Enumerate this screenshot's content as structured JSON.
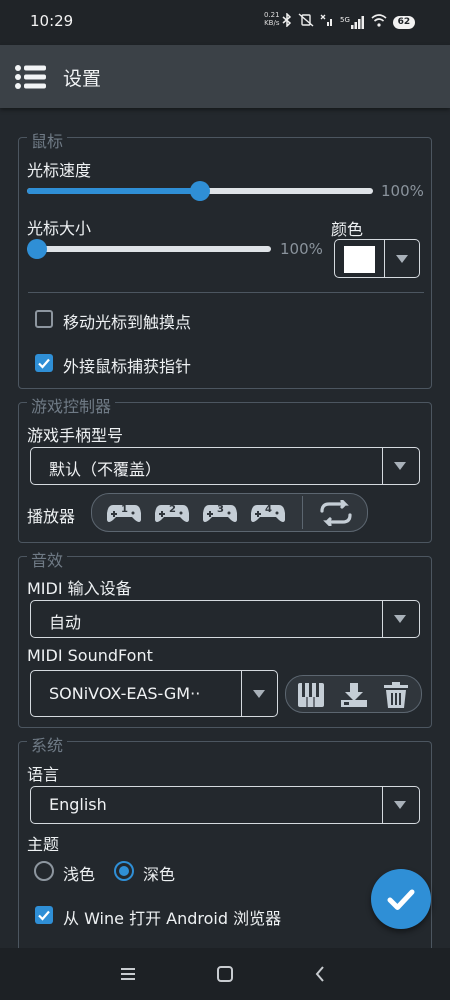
{
  "status_bar": {
    "time": "10:29",
    "net_speed_value": "0.21",
    "net_speed_unit": "KB/s",
    "network": "5G",
    "battery": "62"
  },
  "toolbar": {
    "title": "设置",
    "menu_icon": "list-menu-icon"
  },
  "mouse": {
    "legend": "鼠标",
    "cursor_speed_label": "光标速度",
    "cursor_speed_value": "100%",
    "cursor_speed_level": 0.5,
    "cursor_size_label": "光标大小",
    "cursor_size_value": "100%",
    "cursor_size_level": 0.0,
    "color_label": "颜色",
    "color_value": "#ffffff",
    "move_to_touch_label": "移动光标到触摸点",
    "move_to_touch_checked": false,
    "capture_pointer_label": "外接鼠标捕获指针",
    "capture_pointer_checked": true
  },
  "controller": {
    "legend": "游戏控制器",
    "model_label": "游戏手柄型号",
    "model_value": "默认（不覆盖）",
    "players_label": "播放器",
    "players": [
      "1",
      "2",
      "3",
      "4"
    ]
  },
  "audio": {
    "legend": "音效",
    "midi_input_label": "MIDI 输入设备",
    "midi_input_value": "自动",
    "soundfont_label": "MIDI SoundFont",
    "soundfont_value": "SONiVOX-EAS-GM··"
  },
  "system": {
    "legend": "系统",
    "language_label": "语言",
    "language_value": "English",
    "theme_label": "主题",
    "theme_light": "浅色",
    "theme_dark": "深色",
    "theme_selected": "dark",
    "open_browser_label": "从 Wine 打开 Android 浏览器",
    "open_browser_checked": true
  },
  "colors": {
    "accent": "#2f8fd6",
    "background": "#23282d",
    "toolbar": "#3b4147"
  }
}
